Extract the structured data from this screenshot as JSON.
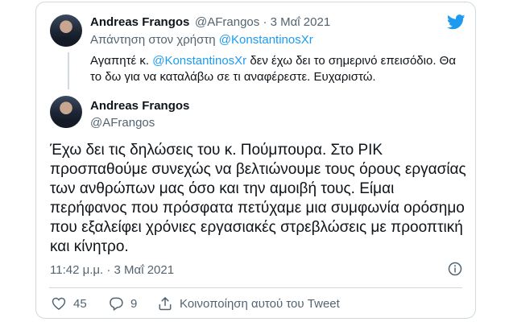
{
  "reply_tweet": {
    "author_name": "Andreas Frangos",
    "author_handle": "@AFrangos",
    "separator": "·",
    "date": "3 Μαΐ 2021",
    "reply_prefix": "Απάντηση στον χρήστη ",
    "reply_to": "@KonstantinosXr",
    "text_prefix": "Αγαπητέ κ. ",
    "text_mention": "@KonstantinosXr",
    "text_suffix": " δεν έχω δει το σημερινό επεισόδιο. Θα το δω για να καταλάβω σε τι αναφέρεστε. Ευχαριστώ."
  },
  "main_tweet": {
    "author_name": "Andreas Frangos",
    "author_handle": "@AFrangos",
    "text": "Έχω δει τις δηλώσεις του κ. Πούμπουρα. Στο ΡΙΚ προσπαθούμε συνεχώς να βελτιώνουμε τους όρους εργασίας των ανθρώπων μας όσο και την αμοιβή τους. Είμαι περήφανος που πρόσφατα πετύχαμε μια συμφωνία ορόσημο που εξαλείφει χρόνιες εργασιακές στρεβλώσεις με προοπτική και κίνητρο.",
    "timestamp": "11:42 μ.μ. · 3 Μαΐ 2021"
  },
  "actions": {
    "likes": "45",
    "replies": "9",
    "share_label": "Κοινοποίηση αυτού του Tweet"
  },
  "colors": {
    "accent": "#1d9bf0",
    "muted": "#536471",
    "border": "#cfd9de"
  },
  "icons": [
    "twitter-bird-icon",
    "info-icon",
    "heart-icon",
    "reply-icon",
    "share-icon"
  ]
}
